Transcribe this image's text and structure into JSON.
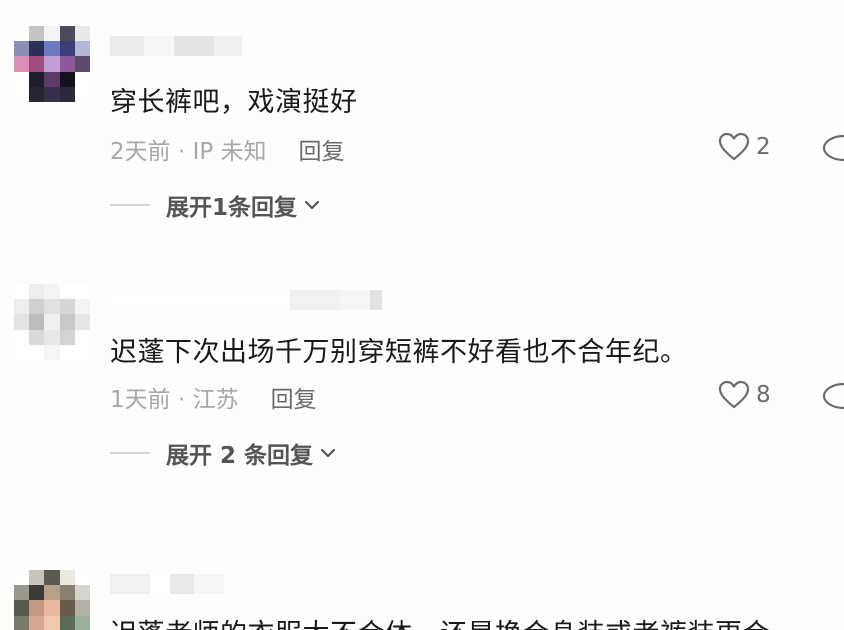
{
  "comments": [
    {
      "text": "穿长裤吧，戏演挺好",
      "meta": "2天前 · IP 未知",
      "reply_label": "回复",
      "likes": "2",
      "expand_label": "展开1条回复"
    },
    {
      "text": "迟蓬下次出场千万别穿短裤不好看也不合年纪。",
      "meta": "1天前 · 江苏",
      "reply_label": "回复",
      "likes": "8",
      "expand_label": "展开 2 条回复"
    },
    {
      "text": "迟蓬老师的衣服太不合体，还是换合身装或者裤装更合"
    }
  ],
  "icons": {
    "like": "heart-outline-icon",
    "expand": "chevron-down-icon",
    "more": "partial-icon"
  },
  "colors": {
    "text_primary": "#1a1a1a",
    "text_meta": "#a8a8a8",
    "text_action": "#6b6b6b"
  }
}
